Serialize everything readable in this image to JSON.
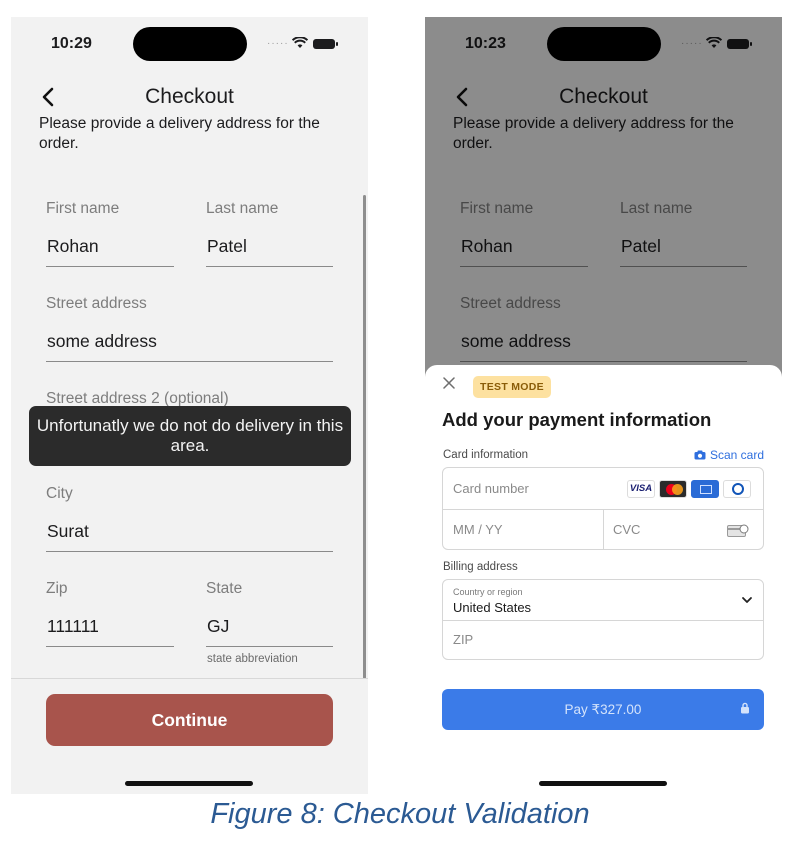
{
  "left_screen": {
    "status_time": "10:29",
    "title": "Checkout",
    "intro": "Please provide a delivery address for the order.",
    "fields": {
      "first_name": {
        "label": "First name",
        "value": "Rohan"
      },
      "last_name": {
        "label": "Last name",
        "value": "Patel"
      },
      "street": {
        "label": "Street address",
        "value": "some address"
      },
      "street2": {
        "label": "Street address 2 (optional)",
        "value": ""
      },
      "city": {
        "label": "City",
        "value": "Surat"
      },
      "zip": {
        "label": "Zip",
        "value": "111111"
      },
      "state": {
        "label": "State",
        "value": "GJ",
        "helper": "state abbreviation"
      }
    },
    "toast": "Unfortunatly we do not do delivery in this area.",
    "continue_label": "Continue",
    "button_color": "#a8544c"
  },
  "right_screen": {
    "status_time": "10:23",
    "title": "Checkout",
    "intro": "Please provide a delivery address for the order.",
    "fields": {
      "first_name": {
        "label": "First name",
        "value": "Rohan"
      },
      "last_name": {
        "label": "Last name",
        "value": "Patel"
      },
      "street": {
        "label": "Street address",
        "value": "some address"
      }
    },
    "sheet": {
      "badge": "TEST MODE",
      "title": "Add your payment information",
      "card_info_label": "Card information",
      "scan_card": "Scan card",
      "card_number_placeholder": "Card number",
      "expiry_placeholder": "MM / YY",
      "cvc_placeholder": "CVC",
      "card_brands": [
        "visa",
        "mastercard",
        "amex",
        "diners"
      ],
      "visa_text": "VISA",
      "billing_label": "Billing address",
      "country_label": "Country or region",
      "country_value": "United States",
      "zip_placeholder": "ZIP",
      "pay_label": "Pay ₹327.00",
      "pay_color": "#3b7be8"
    }
  },
  "caption": "Figure 8: Checkout Validation"
}
